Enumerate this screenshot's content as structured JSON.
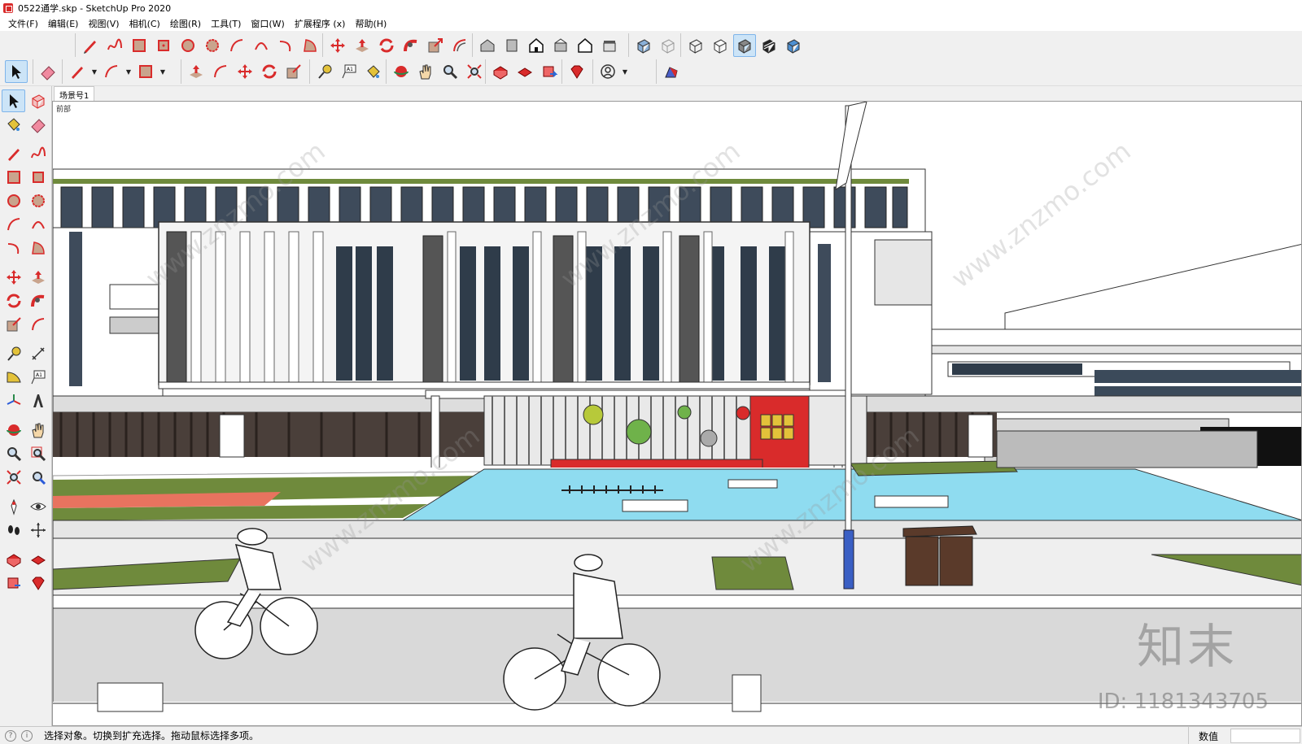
{
  "window": {
    "title": "0522通学.skp - SketchUp Pro 2020"
  },
  "menu": {
    "items": [
      "文件(F)",
      "编辑(E)",
      "视图(V)",
      "相机(C)",
      "绘图(R)",
      "工具(T)",
      "窗口(W)",
      "扩展程序 (x)",
      "帮助(H)"
    ]
  },
  "scene": {
    "tab_label": "场景号1",
    "view_label": "前部"
  },
  "watermark": {
    "brand": "知末",
    "id": "ID: 1181343705",
    "site": "www.znzmo.com"
  },
  "status": {
    "message": "选择对象。切换到扩充选择。拖动鼠标选择多项。",
    "measure_label": "数值",
    "measure_value": ""
  },
  "colors": {
    "accent_red": "#d92b2b",
    "sky": "#ffffff",
    "plaza_blue": "#8fdcf0",
    "lawn_green": "#6f8a3c",
    "running_track": "#e8735f"
  }
}
